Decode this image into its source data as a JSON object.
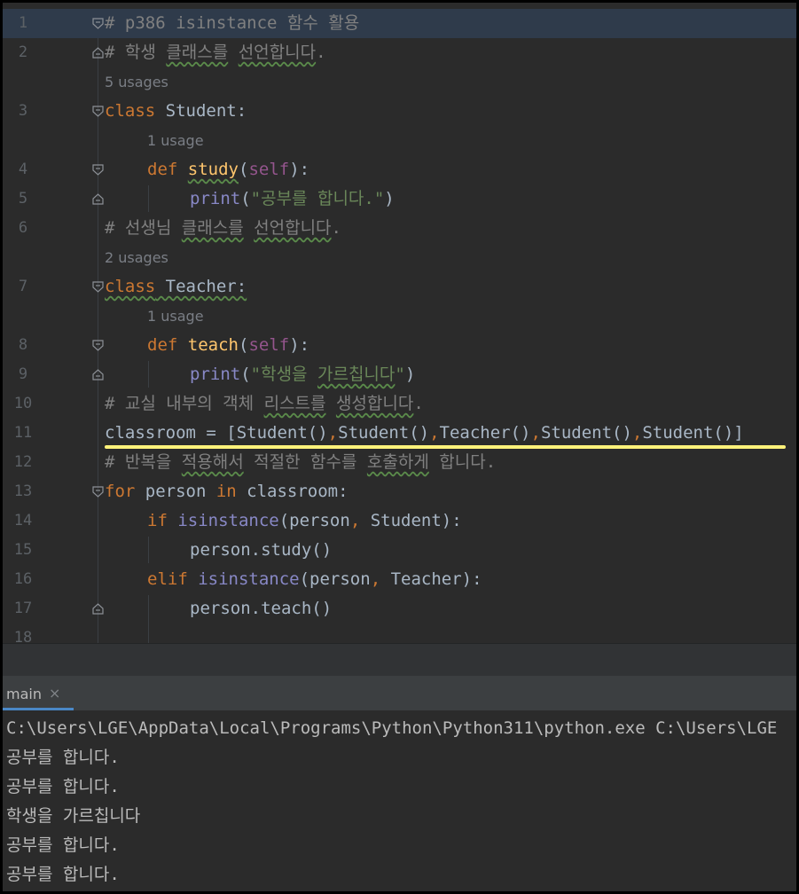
{
  "editor": {
    "line_numbers": [
      "1",
      "2",
      "3",
      "4",
      "5",
      "6",
      "7",
      "8",
      "9",
      "10",
      "11",
      "12",
      "13",
      "14",
      "15",
      "16",
      "17",
      "18"
    ],
    "hints": {
      "student_usages": "5 usages",
      "study_usage": "1 usage",
      "teacher_usages": "2 usages",
      "teach_usage": "1 usage"
    },
    "code": {
      "l1": "# p386 isinstance 함수 활용",
      "l2_hash": "# ",
      "l2_a": "학생",
      "l2_sp1": " ",
      "l2_b": "클래스를",
      "l2_sp2": " ",
      "l2_c": "선언합니다",
      "l2_end": ".",
      "l3_kw": "class",
      "l3_name": " Student:",
      "l4_kw": "def",
      "l4_fn": "study",
      "l4_p1": "(",
      "l4_self": "self",
      "l4_p2": "):",
      "l5_fn": "print",
      "l5_p1": "(",
      "l5_str": "\"공부를 합니다.\"",
      "l5_p2": ")",
      "l6_hash": "# 선생님 ",
      "l6_a": "클래스를",
      "l6_sp": " ",
      "l6_b": "선언합니다",
      "l6_end": ".",
      "l7_kw": "class",
      "l7_name": " Teacher:",
      "l8_kw": "def",
      "l8_fn": "teach",
      "l8_p1": "(",
      "l8_self": "self",
      "l8_p2": "):",
      "l9_fn": "print",
      "l9_p1": "(",
      "l9_str_a": "\"학생을 ",
      "l9_str_b": "가르칩니다",
      "l9_str_c": "\"",
      "l9_p2": ")",
      "l10_hash": "# 교실 내부의 객체 ",
      "l10_a": "리스트를",
      "l10_sp": " ",
      "l10_b": "생성합니다",
      "l10_end": ".",
      "l11_a": "classroom = [Student()",
      "l11_c1": ",",
      "l11_b": "Student()",
      "l11_c2": ",",
      "l11_c": "Teacher()",
      "l11_c3": ",",
      "l11_d": "Student()",
      "l11_c4": ",",
      "l11_e": "Student()]",
      "l12_hash": "# 반복을 ",
      "l12_a": "적용해서",
      "l12_sp": " 적절한 함수를 ",
      "l12_b": "호출하게",
      "l12_end": " 합니다.",
      "l13_kw": "for",
      "l13_mid": " person ",
      "l13_in": "in",
      "l13_end": " classroom:",
      "l14_kw": "if",
      "l14_sp": " ",
      "l14_bi": "isinstance",
      "l14_a": "(person",
      "l14_comma": ",",
      "l14_b": " Student):",
      "l15": "person.study()",
      "l16_kw": "elif",
      "l16_sp": " ",
      "l16_bi": "isinstance",
      "l16_a": "(person",
      "l16_comma": ",",
      "l16_b": " Teacher):",
      "l17": "person.teach()"
    }
  },
  "run": {
    "tab_label": "main",
    "tab_close": "×",
    "output": [
      "C:\\Users\\LGE\\AppData\\Local\\Programs\\Python\\Python311\\python.exe C:\\Users\\LGE",
      "공부를 합니다.",
      "공부를 합니다.",
      "학생을 가르칩니다",
      "공부를 합니다.",
      "공부를 합니다."
    ]
  },
  "colors": {
    "background": "#2b2b2b",
    "keyword": "#cc7832",
    "function": "#ffc66d",
    "self": "#94558d",
    "string": "#6a8759",
    "comment": "#808080",
    "builtin": "#8888c6",
    "highlight_line": "#2f3b4b",
    "annotation_underline": "#fff27a",
    "tab_underline": "#4a88c7"
  },
  "icons": [
    "fold-open-icon",
    "fold-close-icon",
    "close-icon"
  ]
}
